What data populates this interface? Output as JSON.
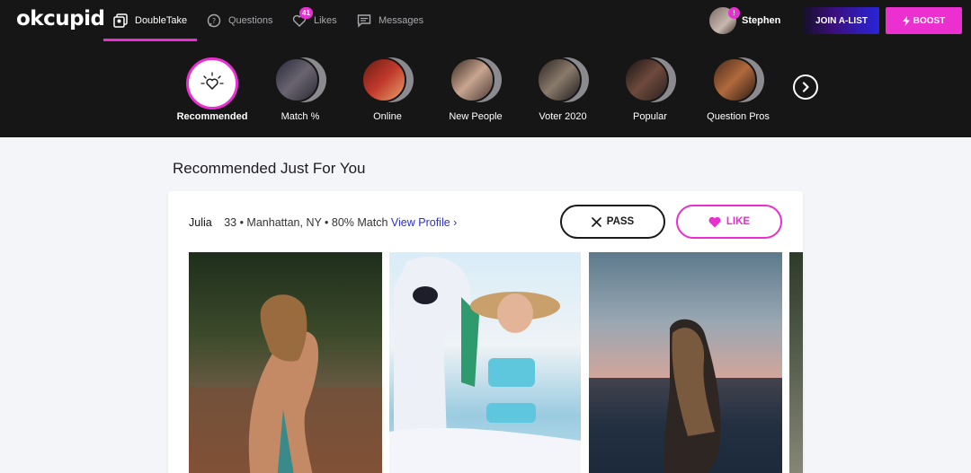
{
  "app": {
    "logo": "okcupid"
  },
  "nav": {
    "items": [
      {
        "label": "DoubleTake",
        "icon": "doubletake-icon",
        "active": true
      },
      {
        "label": "Questions",
        "icon": "question-bubble-icon"
      },
      {
        "label": "Likes",
        "icon": "heart-icon",
        "badge": "41"
      },
      {
        "label": "Messages",
        "icon": "message-icon"
      }
    ],
    "user": {
      "name": "Stephen",
      "badge": "!"
    },
    "join_label": "JOIN A-LIST",
    "boost_label": "BOOST"
  },
  "categories": [
    {
      "label": "Recommended",
      "active": true
    },
    {
      "label": "Match %"
    },
    {
      "label": "Online"
    },
    {
      "label": "New People"
    },
    {
      "label": "Voter 2020"
    },
    {
      "label": "Popular"
    },
    {
      "label": "Question Pros"
    }
  ],
  "main": {
    "heading": "Recommended Just For You",
    "profile": {
      "name": "Julia",
      "details": "33 • Manhattan, NY • 80% Match",
      "view_profile": "View Profile ›"
    },
    "pass_label": "PASS",
    "like_label": "LIKE"
  },
  "colors": {
    "accent": "#e82fd3",
    "nav_bg": "#171617",
    "link": "#2a31c8"
  }
}
